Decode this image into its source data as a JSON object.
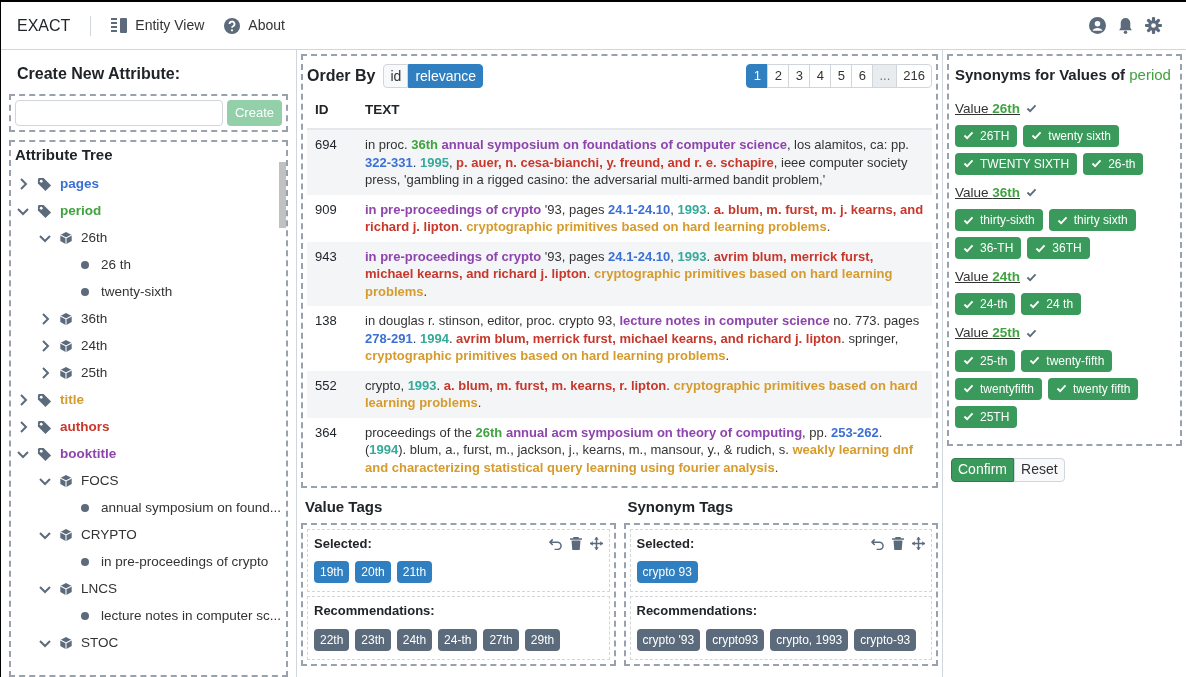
{
  "navbar": {
    "brand": "EXACT",
    "links": [
      {
        "label": "Entity View"
      },
      {
        "label": "About"
      }
    ]
  },
  "create_attribute": {
    "title": "Create New Attribute:",
    "button": "Create",
    "button_disabled": true
  },
  "attribute_tree": {
    "title": "Attribute Tree",
    "items": [
      {
        "label": "pages",
        "color": "#3b6fd4",
        "expanded": false
      },
      {
        "label": "period",
        "color": "#3fa33f",
        "expanded": true,
        "children": [
          {
            "label": "26th",
            "expanded": true,
            "children": [
              {
                "label": "26 th"
              },
              {
                "label": "twenty-sixth"
              }
            ]
          },
          {
            "label": "36th",
            "expanded": false
          },
          {
            "label": "24th",
            "expanded": false
          },
          {
            "label": "25th",
            "expanded": false
          }
        ]
      },
      {
        "label": "title",
        "color": "#d69b2d",
        "expanded": false
      },
      {
        "label": "authors",
        "color": "#c7372b",
        "expanded": false
      },
      {
        "label": "booktitle",
        "color": "#8e44ad",
        "expanded": true,
        "children": [
          {
            "label": "FOCS",
            "expanded": true,
            "children": [
              {
                "label": "annual symposium on found..."
              }
            ]
          },
          {
            "label": "CRYPTO",
            "expanded": true,
            "children": [
              {
                "label": "in pre-proceedings of crypto"
              }
            ]
          },
          {
            "label": "LNCS",
            "expanded": true,
            "children": [
              {
                "label": "lecture notes in computer sc..."
              }
            ]
          },
          {
            "label": "STOC",
            "expanded": true
          }
        ]
      }
    ]
  },
  "order_by": {
    "label": "Order By",
    "options": [
      {
        "label": "id",
        "selected": false
      },
      {
        "label": "relevance",
        "selected": true
      }
    ]
  },
  "pagination": [
    {
      "label": "1",
      "selected": true
    },
    {
      "label": "2",
      "selected": false
    },
    {
      "label": "3",
      "selected": false
    },
    {
      "label": "4",
      "selected": false
    },
    {
      "label": "5",
      "selected": false
    },
    {
      "label": "6",
      "selected": false
    },
    {
      "label": "...",
      "selected": false,
      "disabled": true
    },
    {
      "label": "216",
      "selected": false
    }
  ],
  "table": {
    "columns": [
      "ID",
      "TEXT"
    ],
    "rows": [
      {
        "id": "694",
        "segments": [
          {
            "kind": "plain",
            "text": "in proc. "
          },
          {
            "kind": "period",
            "text": "36th"
          },
          {
            "kind": "booktitle",
            "text": " annual symposium on foundations of computer science"
          },
          {
            "kind": "plain",
            "text": ", los alamitos, ca: pp. "
          },
          {
            "kind": "pages",
            "text": "322-331"
          },
          {
            "kind": "plain",
            "text": ". "
          },
          {
            "kind": "year",
            "text": "1995"
          },
          {
            "kind": "plain",
            "text": ", "
          },
          {
            "kind": "authors",
            "text": "p. auer, n. cesa-bianchi, y. freund, and r. e. schapire"
          },
          {
            "kind": "plain",
            "text": ", ieee computer society press, 'gambling in a rigged casino: the adversarial multi-armed bandit problem,'"
          }
        ]
      },
      {
        "id": "909",
        "segments": [
          {
            "kind": "booktitle",
            "text": "in pre-proceedings of crypto"
          },
          {
            "kind": "plain",
            "text": " '93, pages "
          },
          {
            "kind": "pages",
            "text": "24.1-24.10"
          },
          {
            "kind": "plain",
            "text": ", "
          },
          {
            "kind": "year",
            "text": "1993"
          },
          {
            "kind": "plain",
            "text": ". "
          },
          {
            "kind": "authors",
            "text": "a. blum, m. furst, m. j. kearns, and richard j. lipton"
          },
          {
            "kind": "plain",
            "text": ". "
          },
          {
            "kind": "title",
            "text": "cryptographic primitives based on hard learning problems"
          },
          {
            "kind": "plain",
            "text": "."
          }
        ]
      },
      {
        "id": "943",
        "segments": [
          {
            "kind": "booktitle",
            "text": "in pre-proceedings of crypto"
          },
          {
            "kind": "plain",
            "text": " '93, pages "
          },
          {
            "kind": "pages",
            "text": "24.1-24.10"
          },
          {
            "kind": "plain",
            "text": ", "
          },
          {
            "kind": "year",
            "text": "1993"
          },
          {
            "kind": "plain",
            "text": ". "
          },
          {
            "kind": "authors",
            "text": "avrim blum, merrick furst, michael kearns, and richard j. lipton"
          },
          {
            "kind": "plain",
            "text": ". "
          },
          {
            "kind": "title",
            "text": "cryptographic primitives based on hard learning problems"
          },
          {
            "kind": "plain",
            "text": "."
          }
        ]
      },
      {
        "id": "138",
        "segments": [
          {
            "kind": "plain",
            "text": "in douglas r. stinson, editor, proc. crypto 93, "
          },
          {
            "kind": "booktitle",
            "text": "lecture notes in computer science"
          },
          {
            "kind": "plain",
            "text": " no. 773. pages "
          },
          {
            "kind": "pages",
            "text": "278-291"
          },
          {
            "kind": "plain",
            "text": ". "
          },
          {
            "kind": "year",
            "text": "1994"
          },
          {
            "kind": "plain",
            "text": ". "
          },
          {
            "kind": "authors",
            "text": "avrim blum, merrick furst, michael kearns, and richard j. lipton"
          },
          {
            "kind": "plain",
            "text": ". springer, "
          },
          {
            "kind": "title",
            "text": "cryptographic primitives based on hard learning problems"
          },
          {
            "kind": "plain",
            "text": "."
          }
        ]
      },
      {
        "id": "552",
        "segments": [
          {
            "kind": "plain",
            "text": "crypto, "
          },
          {
            "kind": "year",
            "text": "1993"
          },
          {
            "kind": "plain",
            "text": ". "
          },
          {
            "kind": "authors",
            "text": "a. blum, m. furst, m. kearns, r. lipton"
          },
          {
            "kind": "plain",
            "text": ". "
          },
          {
            "kind": "title",
            "text": "cryptographic primitives based on hard learning problems"
          },
          {
            "kind": "plain",
            "text": "."
          }
        ]
      },
      {
        "id": "364",
        "segments": [
          {
            "kind": "plain",
            "text": "proceedings of the "
          },
          {
            "kind": "period",
            "text": "26th"
          },
          {
            "kind": "booktitle",
            "text": " annual acm symposium on theory of computing"
          },
          {
            "kind": "plain",
            "text": ", pp. "
          },
          {
            "kind": "pages",
            "text": "253-262"
          },
          {
            "kind": "plain",
            "text": ". ("
          },
          {
            "kind": "year",
            "text": "1994"
          },
          {
            "kind": "plain",
            "text": "). blum, a., furst, m., jackson, j., kearns, m., mansour, y., & rudich, s. "
          },
          {
            "kind": "title",
            "text": "weakly learning dnf and characterizing statistical query learning using fourier analysis"
          },
          {
            "kind": "plain",
            "text": "."
          }
        ]
      }
    ]
  },
  "tag_panels": [
    {
      "title": "Value Tags",
      "selected_label": "Selected:",
      "selected": [
        "19th",
        "20th",
        "21th"
      ],
      "recommendations_label": "Recommendations:",
      "recommendations": [
        "22th",
        "23th",
        "24th",
        "24-th",
        "27th",
        "29th"
      ]
    },
    {
      "title": "Synonym Tags",
      "selected_label": "Selected:",
      "selected": [
        "crypto 93"
      ],
      "recommendations_label": "Recommendations:",
      "recommendations": [
        "crypto '93",
        "crypto93",
        "crypto, 1993",
        "crypto-93"
      ]
    }
  ],
  "synonyms": {
    "title": "Synonyms for Values of",
    "attribute": "period",
    "values": [
      {
        "label": "Value",
        "value": "26th",
        "synonyms": [
          {
            "text": "26TH",
            "checked": true
          },
          {
            "text": "twenty sixth",
            "checked": true
          },
          {
            "text": "TWENTY SIXTH",
            "checked": true
          },
          {
            "text": "26-th",
            "checked": true
          }
        ]
      },
      {
        "label": "Value",
        "value": "36th",
        "synonyms": [
          {
            "text": "thirty-sixth",
            "checked": true
          },
          {
            "text": "thirty sixth",
            "checked": true
          },
          {
            "text": "36-TH",
            "checked": true
          },
          {
            "text": "36TH",
            "checked": true
          }
        ]
      },
      {
        "label": "Value",
        "value": "24th",
        "synonyms": [
          {
            "text": "24-th",
            "checked": true
          },
          {
            "text": "24 th",
            "checked": true
          }
        ]
      },
      {
        "label": "Value",
        "value": "25th",
        "synonyms": [
          {
            "text": "25-th",
            "checked": true
          },
          {
            "text": "twenty-fifth",
            "checked": true
          },
          {
            "text": "twentyfifth",
            "checked": true
          },
          {
            "text": "twenty fifth",
            "checked": true
          },
          {
            "text": "25TH",
            "checked": true
          }
        ]
      }
    ],
    "buttons": [
      {
        "label": "Confirm",
        "kind": "primary"
      },
      {
        "label": "Reset",
        "kind": "secondary"
      }
    ]
  }
}
